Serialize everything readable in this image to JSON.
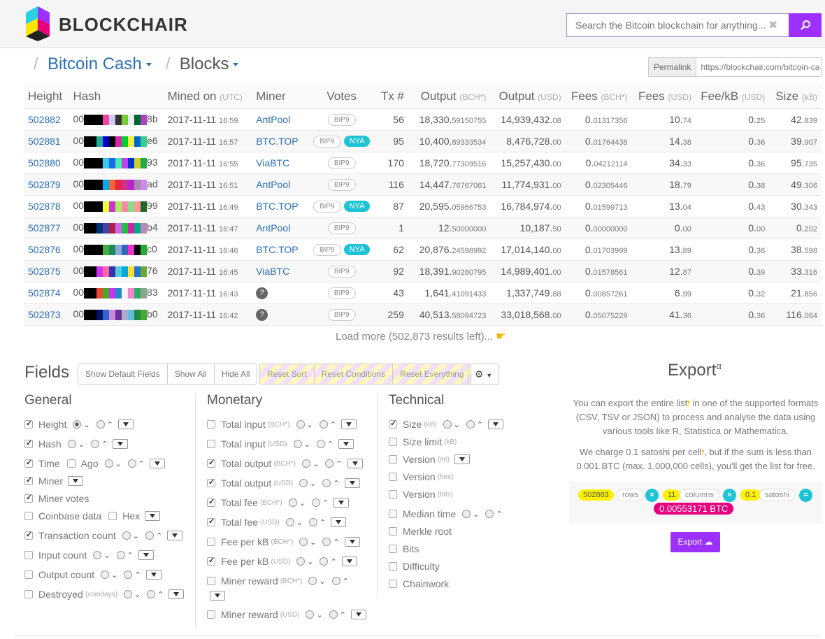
{
  "header": {
    "logo_text": "BLOCKCHAIR",
    "search_placeholder": "Search the Bitcoin blockchain for anything..."
  },
  "breadcrumb": {
    "chain": "Bitcoin Cash",
    "page": "Blocks"
  },
  "permalink": {
    "label": "Permalink",
    "url": "https://blockchair.com/bitcoin-ca"
  },
  "table": {
    "headers": {
      "height": "Height",
      "hash": "Hash",
      "mined": "Mined on",
      "mined_unit": "(UTC)",
      "miner": "Miner",
      "votes": "Votes",
      "tx": "Tx #",
      "output_bch": "Output",
      "output_bch_unit": "(BCH*)",
      "output_usd": "Output",
      "output_usd_unit": "(USD)",
      "fees_bch": "Fees",
      "fees_bch_unit": "(BCH*)",
      "fees_usd": "Fees",
      "fees_usd_unit": "(USD)",
      "feekb": "Fee/kB",
      "feekb_unit": "(USD)",
      "size": "Size",
      "size_unit": "(kB)"
    },
    "rows": [
      {
        "height": "502882",
        "hash_pre": "00",
        "hash_suf": "8b",
        "colors": [
          "#000",
          "#000",
          "#000",
          "#e4a",
          "#cce",
          "#333",
          "#7c3",
          "#eee",
          "#063",
          "#a4b"
        ],
        "date": "2017-11-11",
        "time": "16:59",
        "miner": "AntPool",
        "votes": [
          "BIP9"
        ],
        "tx": "56",
        "out_bch_i": "18,330.",
        "out_bch_d": "59150755",
        "out_usd_i": "14,939,432.",
        "out_usd_d": "08",
        "fee_bch_i": "0.",
        "fee_bch_d": "01317356",
        "fee_usd_i": "10.",
        "fee_usd_d": "74",
        "feekb_i": "0.",
        "feekb_d": "25",
        "size_i": "42.",
        "size_d": "839"
      },
      {
        "height": "502881",
        "hash_pre": "00",
        "hash_suf": "e6",
        "colors": [
          "#000",
          "#000",
          "#2a9",
          "#00c",
          "#000",
          "#d2a",
          "#0c3",
          "#ee4",
          "#06c",
          "#3c8"
        ],
        "date": "2017-11-11",
        "time": "16:57",
        "miner": "BTC.TOP",
        "votes": [
          "BIP9",
          "NYA"
        ],
        "tx": "95",
        "out_bch_i": "10,400.",
        "out_bch_d": "89333534",
        "out_usd_i": "8,476,728.",
        "out_usd_d": "00",
        "fee_bch_i": "0.",
        "fee_bch_d": "01764438",
        "fee_usd_i": "14.",
        "fee_usd_d": "38",
        "feekb_i": "0.",
        "feekb_d": "36",
        "size_i": "39.",
        "size_d": "907"
      },
      {
        "height": "502880",
        "hash_pre": "00",
        "hash_suf": "93",
        "colors": [
          "#000",
          "#000",
          "#000",
          "#3ce",
          "#26e",
          "#4ea",
          "#b4e",
          "#03c",
          "#cc3",
          "#2a4"
        ],
        "date": "2017-11-11",
        "time": "16:55",
        "miner": "ViaBTC",
        "votes": [
          "BIP9"
        ],
        "tx": "170",
        "out_bch_i": "18,720.",
        "out_bch_d": "77309516",
        "out_usd_i": "15,257,430.",
        "out_usd_d": "00",
        "fee_bch_i": "0.",
        "fee_bch_d": "04212114",
        "fee_usd_i": "34.",
        "fee_usd_d": "33",
        "feekb_i": "0.",
        "feekb_d": "36",
        "size_i": "95.",
        "size_d": "735"
      },
      {
        "height": "502879",
        "hash_pre": "00",
        "hash_suf": "ad",
        "colors": [
          "#000",
          "#000",
          "#000",
          "#0ae",
          "#e63",
          "#e24",
          "#c38",
          "#b2c",
          "#a8a",
          "#c8e"
        ],
        "date": "2017-11-11",
        "time": "16:51",
        "miner": "AntPool",
        "votes": [
          "BIP9"
        ],
        "tx": "116",
        "out_bch_i": "14,447.",
        "out_bch_d": "76767061",
        "out_usd_i": "11,774,931.",
        "out_usd_d": "00",
        "fee_bch_i": "0.",
        "fee_bch_d": "02305446",
        "fee_usd_i": "18.",
        "fee_usd_d": "79",
        "feekb_i": "0.",
        "feekb_d": "38",
        "size_i": "49.",
        "size_d": "306"
      },
      {
        "height": "502878",
        "hash_pre": "00",
        "hash_suf": "99",
        "colors": [
          "#000",
          "#000",
          "#000",
          "#ef3",
          "#c3c",
          "#ae6",
          "#f8a",
          "#8d8",
          "#f99",
          "#262"
        ],
        "date": "2017-11-11",
        "time": "16:49",
        "miner": "BTC.TOP",
        "votes": [
          "BIP9",
          "NYA"
        ],
        "tx": "87",
        "out_bch_i": "20,595.",
        "out_bch_d": "05966753",
        "out_usd_i": "16,784,974.",
        "out_usd_d": "00",
        "fee_bch_i": "0.",
        "fee_bch_d": "01599713",
        "fee_usd_i": "13.",
        "fee_usd_d": "04",
        "feekb_i": "0.",
        "feekb_d": "43",
        "size_i": "30.",
        "size_d": "343"
      },
      {
        "height": "502877",
        "hash_pre": "00",
        "hash_suf": "b4",
        "colors": [
          "#000",
          "#000",
          "#037",
          "#44a",
          "#a24",
          "#c6e",
          "#2b4",
          "#c2a",
          "#0a8",
          "#b8b"
        ],
        "date": "2017-11-11",
        "time": "16:47",
        "miner": "AntPool",
        "votes": [
          "BIP9"
        ],
        "tx": "1",
        "out_bch_i": "12.",
        "out_bch_d": "50000000",
        "out_usd_i": "10,187.",
        "out_usd_d": "50",
        "fee_bch_i": "0.",
        "fee_bch_d": "00000000",
        "fee_usd_i": "0.",
        "fee_usd_d": "00",
        "feekb_i": "0.",
        "feekb_d": "00",
        "size_i": "0.",
        "size_d": "202"
      },
      {
        "height": "502876",
        "hash_pre": "00",
        "hash_suf": "c0",
        "colors": [
          "#000",
          "#000",
          "#000",
          "#4a4",
          "#285",
          "#8ad",
          "#36b",
          "#e3c",
          "#000",
          "#2a3"
        ],
        "date": "2017-11-11",
        "time": "16:46",
        "miner": "BTC.TOP",
        "votes": [
          "BIP9",
          "NYA"
        ],
        "tx": "62",
        "out_bch_i": "20,876.",
        "out_bch_d": "24598992",
        "out_usd_i": "17,014,140.",
        "out_usd_d": "00",
        "fee_bch_i": "0.",
        "fee_bch_d": "01703999",
        "fee_usd_i": "13.",
        "fee_usd_d": "89",
        "feekb_i": "0.",
        "feekb_d": "36",
        "size_i": "38.",
        "size_d": "598"
      },
      {
        "height": "502875",
        "hash_pre": "00",
        "hash_suf": "76",
        "colors": [
          "#000",
          "#000",
          "#c3e",
          "#f6a",
          "#33a",
          "#5cd",
          "#0ad",
          "#fd3",
          "#27c",
          "#6a3"
        ],
        "date": "2017-11-11",
        "time": "16:45",
        "miner": "ViaBTC",
        "votes": [
          "BIP9"
        ],
        "tx": "92",
        "out_bch_i": "18,391.",
        "out_bch_d": "90280795",
        "out_usd_i": "14,989,401.",
        "out_usd_d": "00",
        "fee_bch_i": "0.",
        "fee_bch_d": "01578561",
        "fee_usd_i": "12.",
        "fee_usd_d": "87",
        "feekb_i": "0.",
        "feekb_d": "39",
        "size_i": "33.",
        "size_d": "316"
      },
      {
        "height": "502874",
        "hash_pre": "00",
        "hash_suf": "83",
        "colors": [
          "#000",
          "#000",
          "#e43",
          "#4a2",
          "#c3e",
          "#28c",
          "#fef",
          "#e8c",
          "#3a6",
          "#8a8"
        ],
        "date": "2017-11-11",
        "time": "16:43",
        "miner": "?",
        "votes": [
          "BIP9"
        ],
        "tx": "43",
        "out_bch_i": "1,641.",
        "out_bch_d": "41091433",
        "out_usd_i": "1,337,749.",
        "out_usd_d": "88",
        "fee_bch_i": "0.",
        "fee_bch_d": "00857261",
        "fee_usd_i": "6.",
        "fee_usd_d": "99",
        "feekb_i": "0.",
        "feekb_d": "32",
        "size_i": "21.",
        "size_d": "856"
      },
      {
        "height": "502873",
        "hash_pre": "00",
        "hash_suf": "b0",
        "colors": [
          "#000",
          "#000",
          "#016",
          "#36c",
          "#c8d",
          "#639",
          "#aac",
          "#6bd",
          "#284",
          "#4a3"
        ],
        "date": "2017-11-11",
        "time": "16:42",
        "miner": "?",
        "votes": [
          "BIP9"
        ],
        "tx": "259",
        "out_bch_i": "40,513.",
        "out_bch_d": "58094723",
        "out_usd_i": "33,018,568.",
        "out_usd_d": "00",
        "fee_bch_i": "0.",
        "fee_bch_d": "05075229",
        "fee_usd_i": "41.",
        "fee_usd_d": "36",
        "feekb_i": "0.",
        "feekb_d": "36",
        "size_i": "116.",
        "size_d": "064"
      }
    ]
  },
  "load_more": "Load more (502,873 results left)...",
  "fields": {
    "title": "Fields",
    "buttons": [
      "Show Default Fields",
      "Show All",
      "Hide All"
    ],
    "reset_buttons": [
      "Reset Sort",
      "Reset Conditions",
      "Reset Everything"
    ],
    "general_title": "General",
    "monetary_title": "Monetary",
    "technical_title": "Technical",
    "general": {
      "height": "Height",
      "hash": "Hash",
      "time": "Time",
      "ago": "Ago",
      "miner": "Miner",
      "miner_votes": "Miner votes",
      "coinbase": "Coinbase data",
      "hex": "Hex",
      "tx_count": "Transaction count",
      "input_count": "Input count",
      "output_count": "Output count",
      "destroyed": "Destroyed",
      "destroyed_unit": "(coindays)"
    },
    "monetary": {
      "total_input_bch": "Total input",
      "total_input_usd": "Total input",
      "total_output_bch": "Total output",
      "total_output_usd": "Total output",
      "total_fee_bch": "Total fee",
      "total_fee_usd": "Total fee",
      "fee_kb_bch": "Fee per kB",
      "fee_kb_usd": "Fee per kB",
      "miner_reward_bch": "Miner reward",
      "miner_reward_usd": "Miner reward",
      "unit_bch": "(BCH*)",
      "unit_usd": "(USD)"
    },
    "technical": {
      "size": "Size",
      "size_unit": "(kB)",
      "size_limit": "Size limit",
      "size_limit_unit": "(kB)",
      "version_int": "Version",
      "version_int_unit": "(int)",
      "version_hex": "Version",
      "version_hex_unit": "(hex)",
      "version_bits": "Version",
      "version_bits_unit": "(bits)",
      "median_time": "Median time",
      "merkle_root": "Merkle root",
      "bits": "Bits",
      "difficulty": "Difficulty",
      "chainwork": "Chainwork"
    }
  },
  "export": {
    "title": "Export",
    "title_sup": "α",
    "text1a": "You can export the entire list",
    "text1b": " in one of the supported formats (CSV, TSV or JSON) to process and analyse the data using various tools like R, Statistica or Mathematica.",
    "star": "*",
    "text2a": "We charge 0.1 satoshi per cell",
    "text2b": ", but if the sum is less than 0.001 BTC (max. 1,000,000 cells), you'll get the list for free.",
    "rows_val": "502883",
    "rows_lbl": "rows",
    "cols_val": "11",
    "cols_lbl": "columns",
    "sat_val": "0.1",
    "sat_lbl": "satoshi",
    "times": "×",
    "equals": "=",
    "total": "0.00553171 BTC",
    "button": "Export"
  }
}
